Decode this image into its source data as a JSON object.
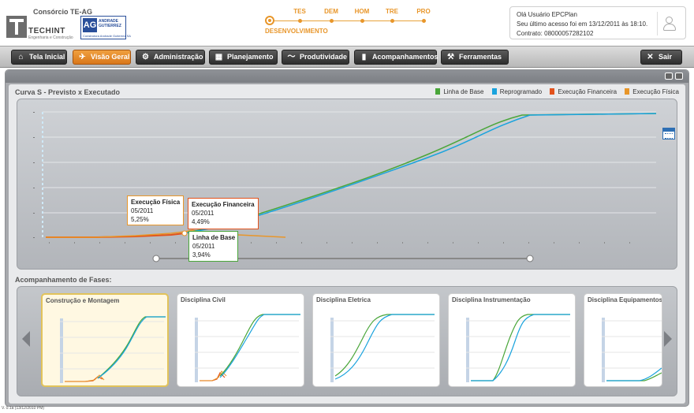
{
  "header": {
    "consorcio": "Consórcio TE-AG",
    "techint_name": "TECHINT",
    "techint_sub": "Engenharia e Construção",
    "ag_logo": "AG",
    "ag_name_1": "ANDRADE",
    "ag_name_2": "GUTIERREZ",
    "ag_sub": "Construtora Andrade Gutierrez SA",
    "phases": [
      "TES",
      "DEM",
      "HOM",
      "TRE",
      "PRO"
    ],
    "current_phase": "DESENVOLVIMENTO",
    "user_greeting": "Olá Usuário EPCPlan",
    "last_access": "Seu último acesso foi em  13/12/2011 às 18:10.",
    "contract": "Contrato: 08000057282102",
    "avatar_icon": "user-icon"
  },
  "nav": {
    "items": [
      {
        "label": "Tela Inicial",
        "icon": "home-icon",
        "active": false
      },
      {
        "label": "Visão Geral",
        "icon": "telescope-icon",
        "active": true
      },
      {
        "label": "Administração",
        "icon": "gear-icon",
        "active": false
      },
      {
        "label": "Planejamento",
        "icon": "map-icon",
        "active": false
      },
      {
        "label": "Produtividade",
        "icon": "chart-icon",
        "active": false
      },
      {
        "label": "Acompanhamentos",
        "icon": "bookmark-icon",
        "active": false
      },
      {
        "label": "Ferramentas",
        "icon": "hammer-icon",
        "active": false
      }
    ],
    "exit_label": "Sair"
  },
  "curva": {
    "title": "Curva S - Previsto x Executado",
    "legend": [
      {
        "label": "Linha de Base",
        "color": "#4aa63a"
      },
      {
        "label": "Reprogramado",
        "color": "#1aa3dd"
      },
      {
        "label": "Execução Financeira",
        "color": "#e2521c"
      },
      {
        "label": "Execução Física",
        "color": "#e8962a"
      }
    ],
    "tooltips": {
      "fisica": {
        "title": "Execução Física",
        "date": "05/2011",
        "value": "5,25%"
      },
      "financeira": {
        "title": "Execução Financeira",
        "date": "05/2011",
        "value": "4,49%"
      },
      "base": {
        "title": "Linha de Base",
        "date": "05/2011",
        "value": "3,94%"
      }
    },
    "calendar_icon": "calendar-icon"
  },
  "fases": {
    "title": "Acompanhamento de Fases:",
    "cards": [
      {
        "title": "Construção e Montagem",
        "selected": true
      },
      {
        "title": "Disciplina Civil",
        "selected": false
      },
      {
        "title": "Disciplina Eletrica",
        "selected": false
      },
      {
        "title": "Disciplina Instrumentação",
        "selected": false
      },
      {
        "title": "Disciplina Equipamentos",
        "selected": false
      }
    ]
  },
  "footer": {
    "version": "V. 0.1a (13/12/2010 PM)"
  }
}
